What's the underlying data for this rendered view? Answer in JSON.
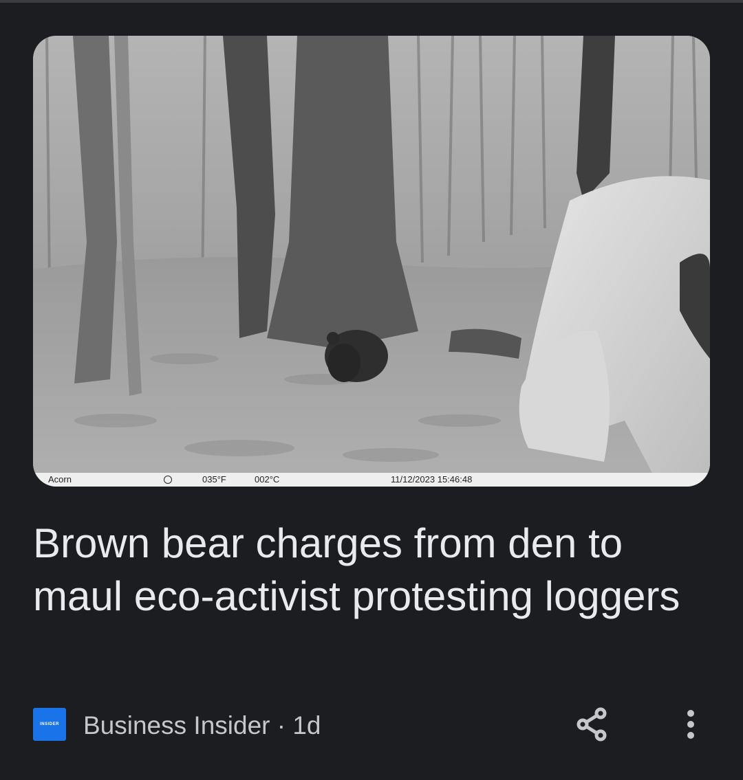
{
  "article": {
    "image_alt": "Trail camera photo of a brown bear near a tree and a person crouching in a forest",
    "camera_overlay": {
      "brand": "Acorn",
      "temp_f": "035°F",
      "temp_c": "002°C",
      "datetime": "11/12/2023 15:46:48"
    },
    "headline": "Brown bear charges from den to maul eco-activist protesting loggers",
    "source_logo_text": "INSIDER",
    "source_name": "Business Insider",
    "separator": "·",
    "age": "1d"
  },
  "icons": {
    "share": "share-icon",
    "more": "more-vertical-icon"
  },
  "colors": {
    "background": "#1b1d20",
    "headline": "#e8eaed",
    "meta_text": "#c4c7cc",
    "logo_bg": "#1a73e8"
  }
}
